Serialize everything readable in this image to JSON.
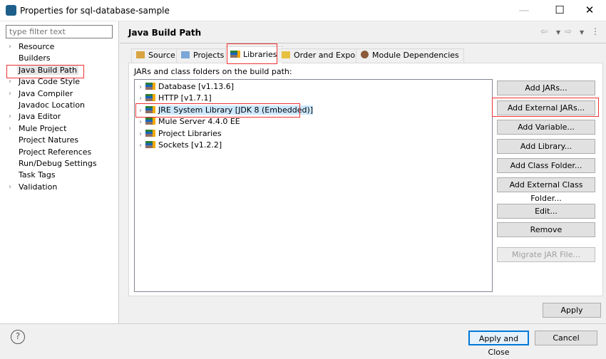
{
  "window": {
    "title": "Properties for sql-database-sample",
    "minimize": "—",
    "maximize": "☐",
    "close": "✕"
  },
  "sidebar": {
    "filter_placeholder": "type filter text",
    "items": [
      {
        "label": "Resource",
        "expandable": true
      },
      {
        "label": "Builders",
        "expandable": false
      },
      {
        "label": "Java Build Path",
        "expandable": false,
        "selected": true
      },
      {
        "label": "Java Code Style",
        "expandable": true
      },
      {
        "label": "Java Compiler",
        "expandable": true
      },
      {
        "label": "Javadoc Location",
        "expandable": false
      },
      {
        "label": "Java Editor",
        "expandable": true
      },
      {
        "label": "Mule Project",
        "expandable": true
      },
      {
        "label": "Project Natures",
        "expandable": false
      },
      {
        "label": "Project References",
        "expandable": false
      },
      {
        "label": "Run/Debug Settings",
        "expandable": false
      },
      {
        "label": "Task Tags",
        "expandable": false
      },
      {
        "label": "Validation",
        "expandable": true
      }
    ]
  },
  "header": {
    "title": "Java Build Path",
    "back": "⇦",
    "forward": "⇨",
    "menu": "⋮"
  },
  "tabs": [
    {
      "label": "Source"
    },
    {
      "label": "Projects"
    },
    {
      "label": "Libraries",
      "active": true
    },
    {
      "label": "Order and Export"
    },
    {
      "label": "Module Dependencies"
    }
  ],
  "libraries": {
    "label": "JARs and class folders on the build path:",
    "items": [
      "Database [v1.13.6]",
      "HTTP [v1.7.1]",
      "JRE System Library [JDK 8 (Embedded)]",
      "Mule Server 4.4.0 EE",
      "Project Libraries",
      "Sockets [v1.2.2]"
    ]
  },
  "buttons": {
    "add_jars": "Add JARs...",
    "add_external_jars": "Add External JARs...",
    "add_variable": "Add Variable...",
    "add_library": "Add Library...",
    "add_class_folder": "Add Class Folder...",
    "add_external_class_folder": "Add External Class Folder...",
    "edit": "Edit...",
    "remove": "Remove",
    "migrate": "Migrate JAR File...",
    "apply": "Apply",
    "apply_close": "Apply and Close",
    "cancel": "Cancel",
    "help": "?"
  },
  "colors": {
    "highlight": "#e33333",
    "selection": "#cce8ff"
  }
}
